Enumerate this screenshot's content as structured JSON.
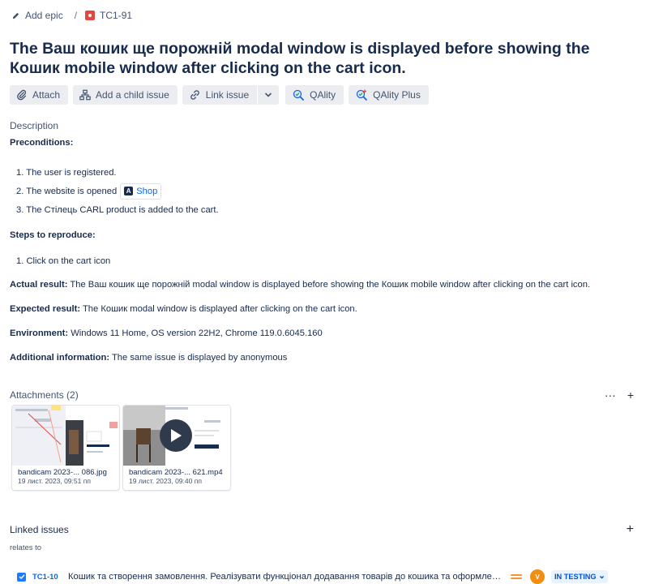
{
  "breadcrumbs": {
    "add_epic": "Add epic",
    "separator": "/",
    "issue_key": "TC1-91"
  },
  "title": "The Ваш кошик ще порожній modal window is displayed before showing the Кошик mobile window after clicking on the cart icon.",
  "toolbar": {
    "attach": "Attach",
    "add_child": "Add a child issue",
    "link_issue": "Link issue",
    "qality": "QAlity",
    "qality_plus": "QAlity Plus"
  },
  "description": {
    "label": "Description",
    "preconditions_heading": "Preconditions:",
    "preconditions": [
      "1. The user is registered.",
      "2. The website is opened",
      "3. The Стілець CARL product is added to the cart."
    ],
    "shop_link": "Shop",
    "steps_heading": "Steps to reproduce:",
    "steps": [
      "1. Click on the cart icon"
    ],
    "actual_label": "Actual result:",
    "actual_text": "The Ваш кошик ще порожній modal window is displayed before showing the Кошик mobile window after clicking on the cart icon.",
    "expected_label": "Expected result:",
    "expected_text": "The Кошик modal window is displayed after clicking on the cart icon.",
    "environment_label": "Environment:",
    "environment_text": "Windows 11 Home, OS version 22H2, Chrome 119.0.6045.160",
    "additional_label": "Additional information:",
    "additional_text": "The same issue is displayed by anonymous"
  },
  "attachments": {
    "label": "Attachments (2)",
    "more": "···",
    "add": "+",
    "items": [
      {
        "name": "bandicam 2023-... 086.jpg",
        "date": "19 лист. 2023, 09:51 пп"
      },
      {
        "name": "bandicam 2023-... 621.mp4",
        "date": "19 лист. 2023, 09:40 пп"
      }
    ]
  },
  "linked": {
    "label": "Linked issues",
    "add": "+",
    "relation": "relates to",
    "item": {
      "key": "TC1-10",
      "summary": "Кошик та створення замовлення. Реалізувати функціонал додавання товарів до кошика та оформлення замовлення",
      "avatar": "V",
      "status": "IN TESTING"
    }
  },
  "colors": {
    "accent": "#0c66e4",
    "bug": "#e2483d",
    "priority": "#f79232",
    "avatar": "#f18d13",
    "status_bg": "#e9f2ff"
  }
}
